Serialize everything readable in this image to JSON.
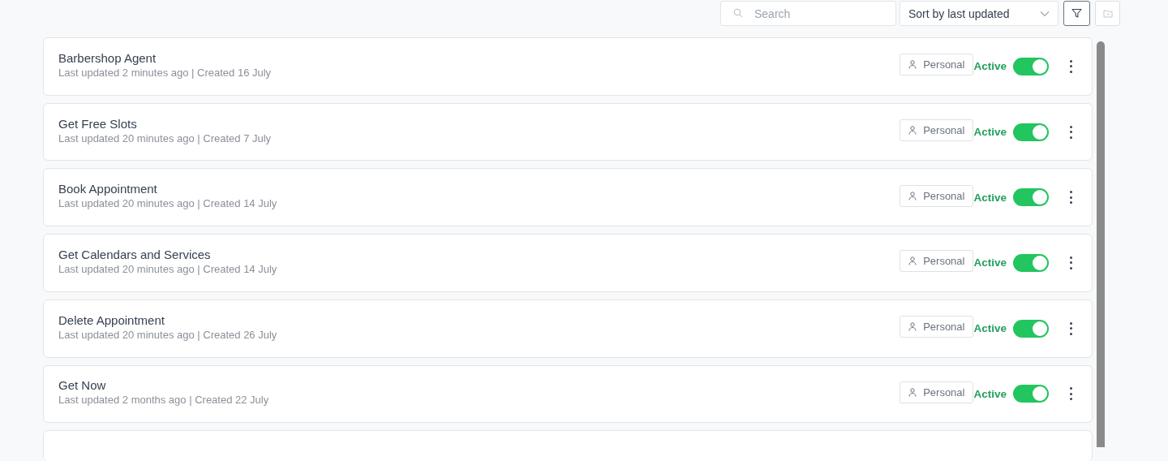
{
  "toolbar": {
    "search": {
      "placeholder": "Search"
    },
    "sort": {
      "value": "Sort by last updated"
    }
  },
  "agents": [
    {
      "name": "Barbershop Agent",
      "meta": "Last updated 2 minutes ago | Created 16 July",
      "tag": "Personal",
      "status": "Active",
      "on": true
    },
    {
      "name": "Get Free Slots",
      "meta": "Last updated 20 minutes ago | Created 7 July",
      "tag": "Personal",
      "status": "Active",
      "on": true
    },
    {
      "name": "Book Appointment",
      "meta": "Last updated 20 minutes ago | Created 14 July",
      "tag": "Personal",
      "status": "Active",
      "on": true
    },
    {
      "name": "Get Calendars and Services",
      "meta": "Last updated 20 minutes ago | Created 14 July",
      "tag": "Personal",
      "status": "Active",
      "on": true
    },
    {
      "name": "Delete Appointment",
      "meta": "Last updated 20 minutes ago | Created 26 July",
      "tag": "Personal",
      "status": "Active",
      "on": true
    },
    {
      "name": "Get Now",
      "meta": "Last updated 2 months ago | Created 22 July",
      "tag": "Personal",
      "status": "Active",
      "on": true
    }
  ]
}
